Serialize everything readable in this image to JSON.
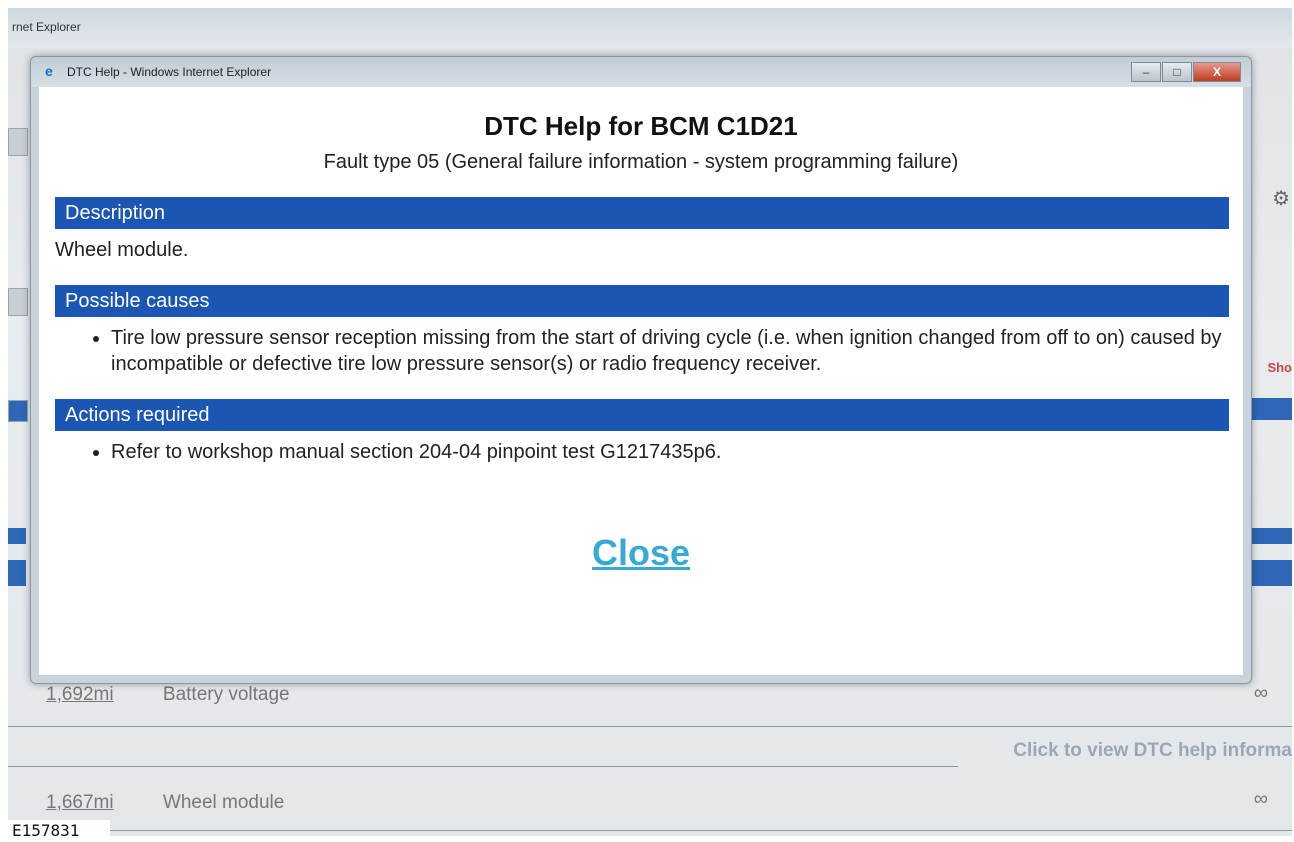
{
  "outer_window": {
    "title": "rnet Explorer"
  },
  "background_rows": [
    {
      "distance": "1,692mi",
      "label": "Battery voltage"
    },
    {
      "distance": "1,667mi",
      "label": "Wheel module"
    }
  ],
  "background_help_link": "Click to view DTC help informa",
  "background_right_text": "Sho",
  "popup": {
    "window_title": "DTC Help - Windows Internet Explorer",
    "controls": {
      "minimize": "–",
      "maximize": "□",
      "close": "X"
    },
    "heading": "DTC Help for BCM C1D21",
    "subheading": "Fault type 05 (General failure information - system programming failure)",
    "sections": {
      "description": {
        "header": "Description",
        "text": "Wheel module."
      },
      "possible_causes": {
        "header": "Possible causes",
        "items": [
          "Tire low pressure sensor reception missing from the start of driving cycle (i.e. when ignition changed from off to on) caused by incompatible or defective tire low pressure sensor(s) or radio frequency receiver."
        ]
      },
      "actions_required": {
        "header": "Actions required",
        "items": [
          "Refer to workshop manual section 204-04 pinpoint test G1217435p6."
        ]
      }
    },
    "close_label": "Close"
  },
  "figure_id": "E157831",
  "colors": {
    "section_bar": "#1c56b4",
    "close_link": "#36a9d6"
  }
}
